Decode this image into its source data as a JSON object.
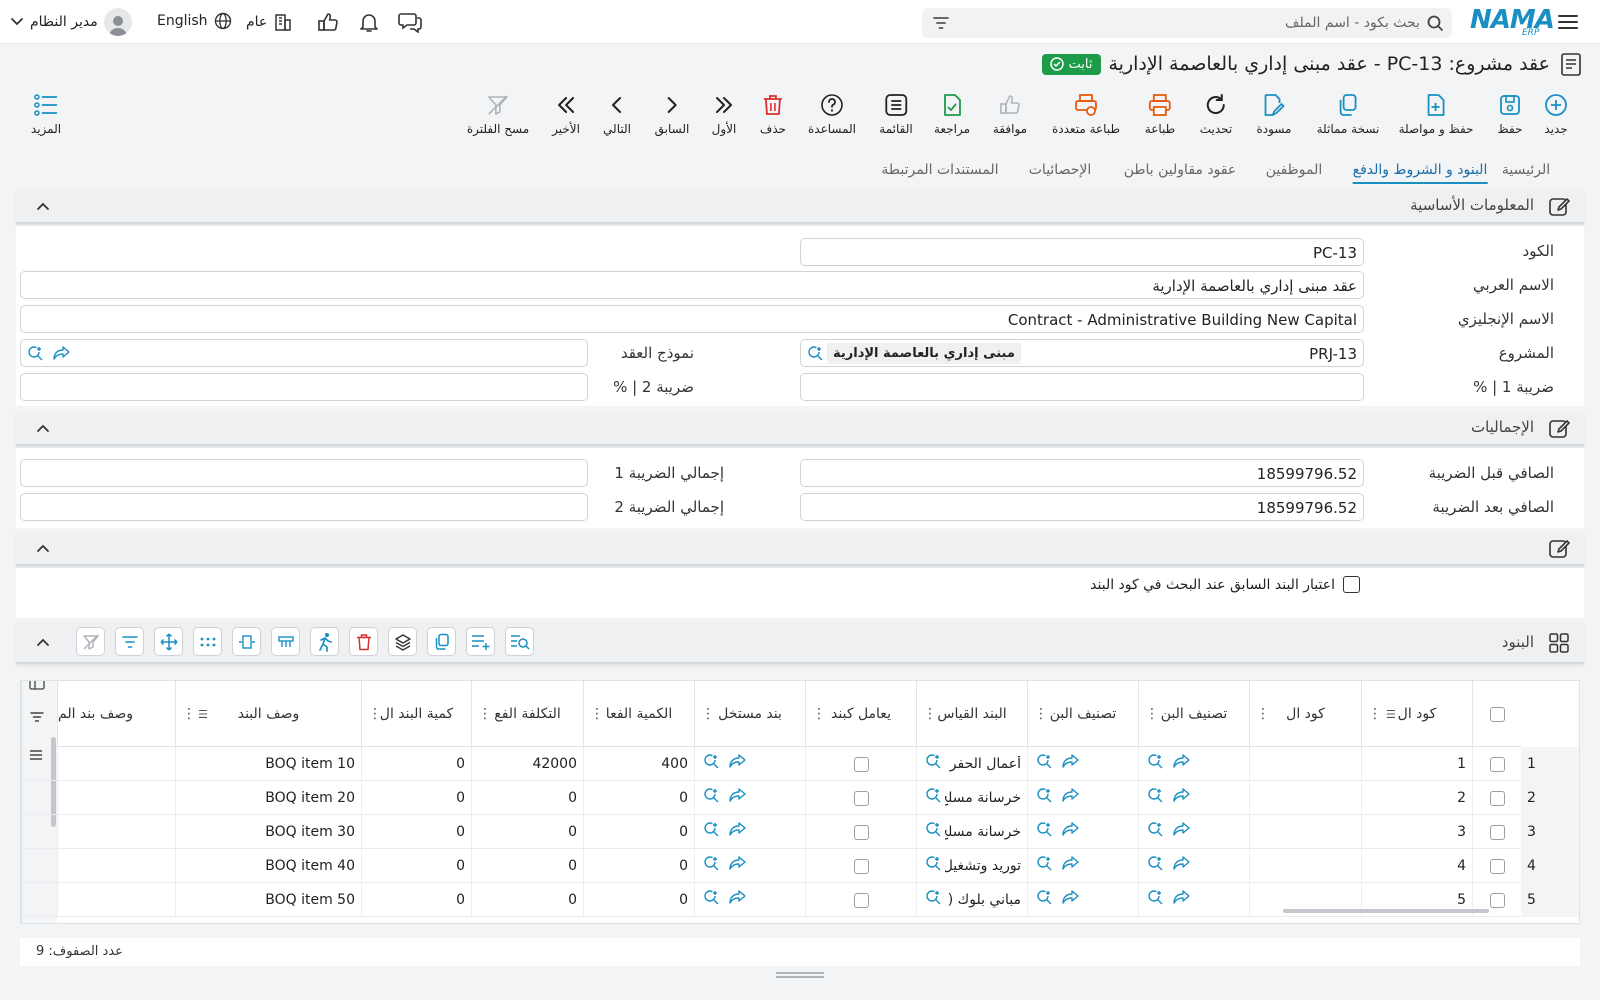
{
  "topbar": {
    "user_name": "مدير النظام",
    "language": "English",
    "branch": "عام",
    "search_placeholder": "بحث بكود - اسم الملف",
    "logo_text": "NAMA",
    "logo_sub": "ERP"
  },
  "title": {
    "text": "عقد مشروع: PC-13 - عقد مبنى إداري بالعاصمة الإدارية",
    "status": "ثابت"
  },
  "toolbar": {
    "new": "جديد",
    "save": "حفظ",
    "save_continue": "حفظ و مواصلة",
    "duplicate": "نسخة مماثلة",
    "draft": "مسودة",
    "refresh": "تحديث",
    "print": "طباعة",
    "multi_print": "طباعة متعددة",
    "approve": "موافقة",
    "review": "مراجعة",
    "list": "القائمة",
    "help": "المساعدة",
    "delete": "حذف",
    "first": "الأول",
    "previous": "السابق",
    "next": "التالي",
    "last": "الأخير",
    "clear_filter": "مسح الفلترة",
    "more": "المزيد"
  },
  "tabs": [
    "الرئيسية",
    "البنود و الشروط والدفع",
    "الموظفين",
    "عقود مقاولين باطن",
    "الإحصائيات",
    "المستندات المرتبطة"
  ],
  "basic_info": {
    "title": "المعلومات الأساسية",
    "code_label": "الكود",
    "code_value": "PC-13",
    "arabic_name_label": "الاسم العربي",
    "arabic_name_value": "عقد مبنى إداري بالعاصمة الإدارية",
    "english_name_label": "الاسم الإنجليزي",
    "english_name_value": "Contract - Administrative Building New Capital",
    "project_label": "المشروع",
    "project_code": "PRJ-13",
    "project_name": "مبنى إداري بالعاصمة الإدارية",
    "contract_template_label": "نموذج العقد",
    "tax1_label": "ضريبة 1 | %",
    "tax2_label": "ضريبة 2 | %"
  },
  "totals": {
    "title": "الإجماليات",
    "net_before_tax_label": "الصافي قبل الضريبة",
    "net_before_tax_value": "18599796.52",
    "net_after_tax_label": "الصافي بعد الضريبة",
    "net_after_tax_value": "18599796.52",
    "tax1_total_label": "إجمالي الضريبة 1",
    "tax2_total_label": "إجمالي الضريبة 2"
  },
  "options": {
    "prev_item_checkbox_label": "اعتبار البند السابق عند البحث في كود البند"
  },
  "items": {
    "title": "البنود",
    "columns": [
      "كود ال",
      "كود ال",
      "تصنيف البن",
      "تصنيف البن",
      "البند القياس",
      "يعامل كبند",
      "بند مستخل",
      "الكمية الفعا",
      "التكلفة الفع",
      "كمية البند ال",
      "وصف البند",
      "وصف بند الم"
    ],
    "rows": [
      {
        "n": "1",
        "code": "1",
        "std": "أعمال الحفر و",
        "qty": "400",
        "cost": "42000",
        "bqty": "0",
        "desc": "BOQ item 10"
      },
      {
        "n": "2",
        "code": "2",
        "std": "خرسانة مسلح",
        "qty": "0",
        "cost": "0",
        "bqty": "0",
        "desc": "BOQ item 20"
      },
      {
        "n": "3",
        "code": "3",
        "std": "خرسانة مسلح",
        "qty": "0",
        "cost": "0",
        "bqty": "0",
        "desc": "BOQ item 30"
      },
      {
        "n": "4",
        "code": "4",
        "std": "توريد وتشغيل",
        "qty": "0",
        "cost": "0",
        "bqty": "0",
        "desc": "BOQ item 40"
      },
      {
        "n": "5",
        "code": "5",
        "std": "مباني بلوك (",
        "qty": "0",
        "cost": "0",
        "bqty": "0",
        "desc": "BOQ item 50"
      }
    ],
    "row_count_text": "عدد الصفوف: 9"
  },
  "colors": {
    "accent": "#1a8fc2",
    "status_green": "#1e9b48",
    "print_orange": "#e8590c",
    "delete_red": "#d63031"
  }
}
